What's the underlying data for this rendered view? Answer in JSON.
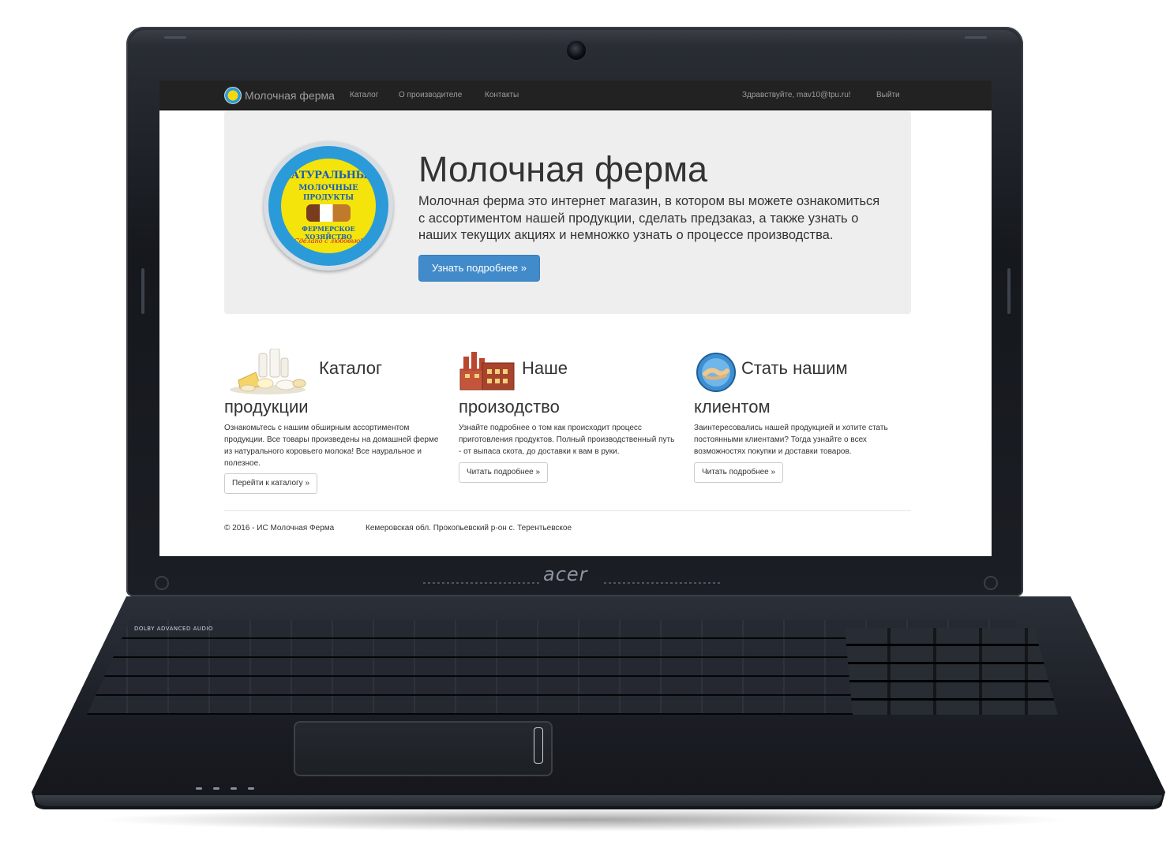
{
  "device": {
    "brand": "acer"
  },
  "keyboard": {
    "top_labels": "DOLBY  ADVANCED AUDIO"
  },
  "navbar": {
    "brand": "Молочная ферма",
    "links": [
      "Каталог",
      "О производителе",
      "Контакты"
    ],
    "greeting": "Здравствуйте, mav10@tpu.ru!",
    "logout": "Выйти"
  },
  "hero": {
    "logo": {
      "line1": "НАТУРАЛЬНЫЕ",
      "line2": "МОЛОЧНЫЕ",
      "line3": "ПРОДУКТЫ",
      "line4": "ФЕРМЕРСКОЕ ХОЗЯЙСТВО",
      "line5": "Сделано с любовью!"
    },
    "title": "Молочная ферма",
    "text": "Молочная ферма это интернет магазин, в котором вы можете ознакомиться с ассортиментом нашей продукции, сделать предзаказ, а также узнать о наших текущих акциях и немножко узнать о процессе производства.",
    "button": "Узнать подробнее »"
  },
  "features": [
    {
      "icon": "dairy-products-icon",
      "title_line1": "Каталог",
      "title_line2": "продукции",
      "description": "Ознакомьтесь с нашим обширным ассортиментом продукции. Все товары произведены на домашней ферме из натурального коровьего молока! Все науральное и полезное.",
      "button": "Перейти к каталогу »"
    },
    {
      "icon": "factory-icon",
      "title_line1": "Наше",
      "title_line2": "произодство",
      "description": "Узнайте подробнее о том как происходит процесс приготовления продуктов. Полный производственный путь - от выпаса скота, до доставки к вам в руки.",
      "button": "Читать подробнее »"
    },
    {
      "icon": "handshake-icon",
      "title_line1": "Стать нашим",
      "title_line2": "клиентом",
      "description": "Заинтересовались нашей продукцией и хотите стать постоянными клиентами? Тогда узнайте о всех возможностях покупки и доставки товаров.",
      "button": "Читать подробнее »"
    }
  ],
  "footer": {
    "copyright": "© 2016 - ИС Молочная Ферма",
    "address": "Кемеровская обл. Прокопьевский р-он с. Терентьевское"
  }
}
